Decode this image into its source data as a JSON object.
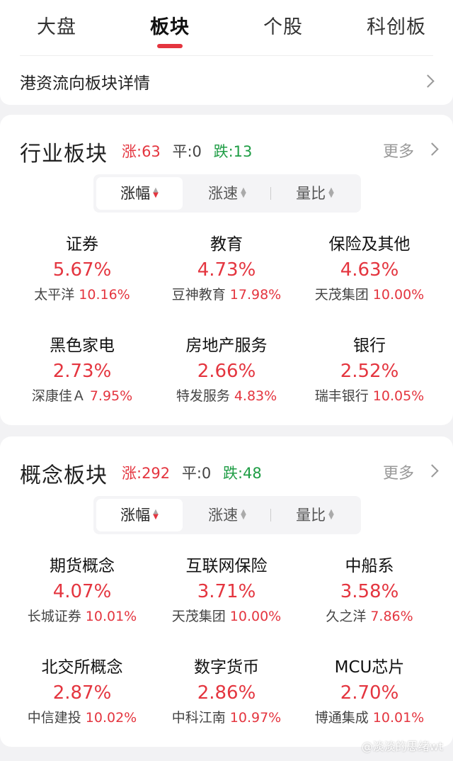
{
  "tabs": [
    {
      "label": "大盘"
    },
    {
      "label": "板块"
    },
    {
      "label": "个股"
    },
    {
      "label": "科创板"
    }
  ],
  "hk_flow": {
    "label": "港资流向板块详情"
  },
  "industry": {
    "title": "行业板块",
    "up": "涨:63",
    "flat": "平:0",
    "down": "跌:13",
    "more": "更多",
    "sort": [
      "涨幅",
      "涨速",
      "量比"
    ],
    "items": [
      {
        "name": "证券",
        "pct": "5.67%",
        "leader": "太平洋",
        "leader_pct": "10.16%"
      },
      {
        "name": "教育",
        "pct": "4.73%",
        "leader": "豆神教育",
        "leader_pct": "17.98%"
      },
      {
        "name": "保险及其他",
        "pct": "4.63%",
        "leader": "天茂集团",
        "leader_pct": "10.00%"
      },
      {
        "name": "黑色家电",
        "pct": "2.73%",
        "leader": "深康佳Ａ",
        "leader_pct": "7.95%"
      },
      {
        "name": "房地产服务",
        "pct": "2.66%",
        "leader": "特发服务",
        "leader_pct": "4.83%"
      },
      {
        "name": "银行",
        "pct": "2.52%",
        "leader": "瑞丰银行",
        "leader_pct": "10.05%"
      }
    ]
  },
  "concept": {
    "title": "概念板块",
    "up": "涨:292",
    "flat": "平:0",
    "down": "跌:48",
    "more": "更多",
    "sort": [
      "涨幅",
      "涨速",
      "量比"
    ],
    "items": [
      {
        "name": "期货概念",
        "pct": "4.07%",
        "leader": "长城证券",
        "leader_pct": "10.01%"
      },
      {
        "name": "互联网保险",
        "pct": "3.71%",
        "leader": "天茂集团",
        "leader_pct": "10.00%"
      },
      {
        "name": "中船系",
        "pct": "3.58%",
        "leader": "久之洋",
        "leader_pct": "7.86%"
      },
      {
        "name": "北交所概念",
        "pct": "2.87%",
        "leader": "中信建投",
        "leader_pct": "10.02%"
      },
      {
        "name": "数字货币",
        "pct": "2.86%",
        "leader": "中科江南",
        "leader_pct": "10.97%"
      },
      {
        "name": "MCU芯片",
        "pct": "2.70%",
        "leader": "博通集成",
        "leader_pct": "10.01%"
      }
    ]
  },
  "colors": {
    "up": "#e4353f",
    "down": "#1f9d45",
    "accent": "#e4353f"
  },
  "watermark": "@淡淡的思绪wt"
}
